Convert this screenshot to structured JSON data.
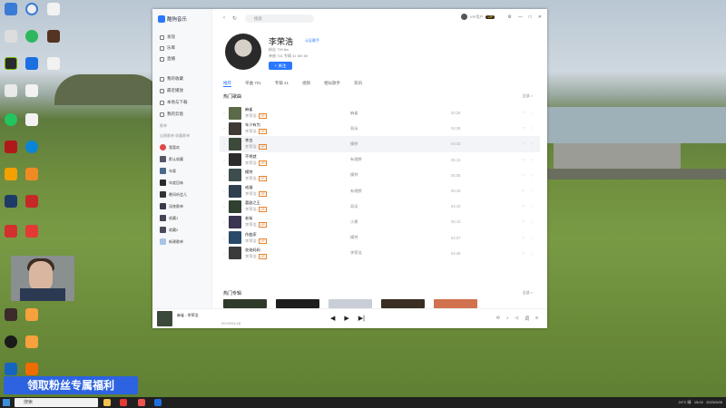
{
  "desktop": {
    "promo_banner": "领取粉丝专属福利",
    "taskbar_search": "搜索"
  },
  "app": {
    "name": "酷狗音乐",
    "sidebar": {
      "main_items": [
        "发现",
        "乐库",
        "直播"
      ],
      "my_items": [
        "我的收藏",
        "最近播放",
        "本地与下载",
        "我的云盘"
      ],
      "section_label": "歌单",
      "section_tabs": "自建歌单  收藏歌单",
      "playlists": [
        "我喜欢",
        "默认收藏",
        "车载",
        "年度回味",
        "晚间听会儿",
        "深夜歌单",
        "收藏1",
        "收藏2",
        "新建歌单"
      ]
    },
    "topbar": {
      "search_placeholder": "搜索",
      "username": "VIP用户",
      "vip": "VIP",
      "window_controls": [
        "⚙",
        "—",
        "□",
        "✕"
      ]
    },
    "artist": {
      "name": "李荣浩",
      "verified": "认证歌手",
      "meta1": "粉丝 799.8w",
      "meta2": "单曲 701  专辑 41  MV 89",
      "follow": "+ 关注"
    },
    "tabs": [
      "推荐",
      "单曲 701",
      "专辑 41",
      "视频",
      "相似歌手",
      "资讯"
    ],
    "hot_songs": {
      "title": "热门歌曲",
      "more": "全部 >",
      "songs": [
        {
          "title": "麻雀",
          "artist": "李荣浩",
          "album": "麻雀",
          "duration": "04:28",
          "highlight": false
        },
        {
          "title": "年少有为",
          "artist": "李荣浩",
          "album": "耳朵",
          "duration": "04:39",
          "highlight": false
        },
        {
          "title": "李白",
          "artist": "李荣浩",
          "album": "模特",
          "duration": "04:33",
          "highlight": true
        },
        {
          "title": "不将就",
          "artist": "李荣浩",
          "album": "有理想",
          "duration": "05:13",
          "highlight": false
        },
        {
          "title": "模特",
          "artist": "李荣浩",
          "album": "模特",
          "duration": "05:06",
          "highlight": false
        },
        {
          "title": "戒烟",
          "artist": "李荣浩",
          "album": "有理想",
          "duration": "05:19",
          "highlight": false
        },
        {
          "title": "喜剧之王",
          "artist": "李荣浩",
          "album": "耳朵",
          "duration": "04:10",
          "highlight": false
        },
        {
          "title": "老街",
          "artist": "李荣浩",
          "album": "小黄",
          "duration": "05:10",
          "highlight": false
        },
        {
          "title": "作曲家",
          "artist": "李荣浩",
          "album": "模特",
          "duration": "04:07",
          "highlight": false
        },
        {
          "title": "爸爸妈妈",
          "artist": "李荣浩",
          "album": "李荣浩",
          "duration": "04:36",
          "highlight": false
        }
      ]
    },
    "hot_albums": {
      "title": "热门专辑",
      "more": "全部 >"
    },
    "player": {
      "now_playing": "麻雀 - 李荣浩",
      "time": "00:00/04:28",
      "prev": "◀",
      "play": "▶",
      "next": "▶|"
    }
  },
  "tray": {
    "weather": "24°C 晴",
    "time": "15:02",
    "date": "2023/9/26"
  }
}
